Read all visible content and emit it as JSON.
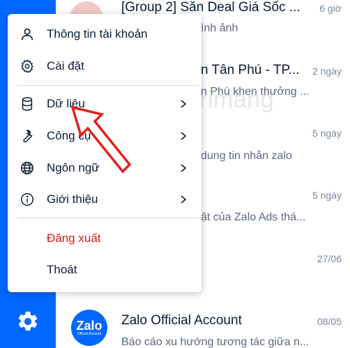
{
  "menu": {
    "items": [
      {
        "label": "Thông tin tài khoản",
        "icon": "user-icon"
      },
      {
        "label": "Cài đặt",
        "icon": "gear-icon"
      },
      {
        "label": "Dữ liệu",
        "icon": "database-icon",
        "has_submenu": true
      },
      {
        "label": "Công cụ",
        "icon": "wrench-icon",
        "has_submenu": true
      },
      {
        "label": "Ngôn ngữ",
        "icon": "globe-icon",
        "has_submenu": true
      },
      {
        "label": "Giới thiệu",
        "icon": "info-icon",
        "has_submenu": true
      }
    ],
    "logout_label": "Đăng xuất",
    "exit_label": "Thoát",
    "logout_color": "#d91b1b"
  },
  "conversations": [
    {
      "title": "[Group 2] Săn Deal Giá Sốc ...",
      "time": "6 giờ",
      "preview": "ình ảnh"
    },
    {
      "title": "n Tân Phú - TP...",
      "time": "2 ngày",
      "preview": "n Phú khen thưởng ..."
    },
    {
      "title": "",
      "time": "5 ngày",
      "preview": "dung tin nhắn zalo"
    },
    {
      "title": "",
      "time": "5 ngày",
      "preview": "ật của Zalo Ads thá..."
    },
    {
      "title": "",
      "time": "27/06",
      "preview": ""
    },
    {
      "title": "Zalo Official Account",
      "time": "08/05",
      "preview": "Báo cáo xu hướng tương tác giữa n..."
    }
  ],
  "zalo_avatar": {
    "logo": "Zalo",
    "sub": "Official Account"
  },
  "watermark": "uantrimang",
  "colors": {
    "nav": "#0068ff",
    "accent": "#0068ff",
    "annotation": "#e02020"
  }
}
